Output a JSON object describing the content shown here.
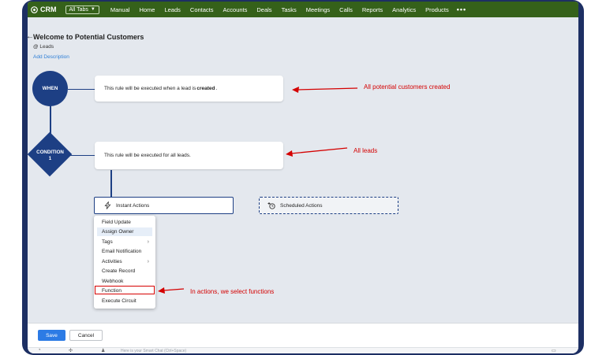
{
  "app": {
    "name": "CRM"
  },
  "nav": {
    "all_tabs": "All Tabs",
    "items": [
      "Manual",
      "Home",
      "Leads",
      "Contacts",
      "Accounts",
      "Deals",
      "Tasks",
      "Meetings",
      "Calls",
      "Reports",
      "Analytics",
      "Products"
    ],
    "more": "•••"
  },
  "page": {
    "title": "Welcome to Potential Customers",
    "module": "@ Leads",
    "add_description": "Add Description"
  },
  "flow": {
    "when": {
      "label": "WHEN",
      "text_prefix": "This rule will be executed when a lead is ",
      "text_bold": "created",
      "text_suffix": "."
    },
    "condition": {
      "label": "CONDITION",
      "number": "1",
      "text": "This rule will be executed for all leads."
    },
    "instant_actions": "Instant Actions",
    "scheduled_actions": "Scheduled Actions"
  },
  "menu": {
    "items": [
      {
        "label": "Field Update",
        "submenu": false,
        "highlighted": false
      },
      {
        "label": "Assign Owner",
        "submenu": false,
        "highlighted": true
      },
      {
        "label": "Tags",
        "submenu": true,
        "highlighted": false
      },
      {
        "label": "Email Notification",
        "submenu": false,
        "highlighted": false
      },
      {
        "label": "Activities",
        "submenu": true,
        "highlighted": false
      },
      {
        "label": "Create Record",
        "submenu": false,
        "highlighted": false
      },
      {
        "label": "Webhook",
        "submenu": false,
        "highlighted": false
      },
      {
        "label": "Function",
        "submenu": false,
        "highlighted": false,
        "boxed": true
      },
      {
        "label": "Execute Circuit",
        "submenu": false,
        "highlighted": false
      }
    ],
    "submenu_arrow": "›"
  },
  "annotations": {
    "created": "All potential customers created",
    "leads": "All leads",
    "function": "In actions, we select functions"
  },
  "footer": {
    "save": "Save",
    "cancel": "Cancel"
  },
  "chatbar": {
    "placeholder": "Here is your Smart Chat (Ctrl+Space)"
  },
  "colors": {
    "nav_bg": "#35611a",
    "flow_blue": "#1d3f84",
    "annotation_red": "#d40000",
    "save_blue": "#2c7be5"
  }
}
